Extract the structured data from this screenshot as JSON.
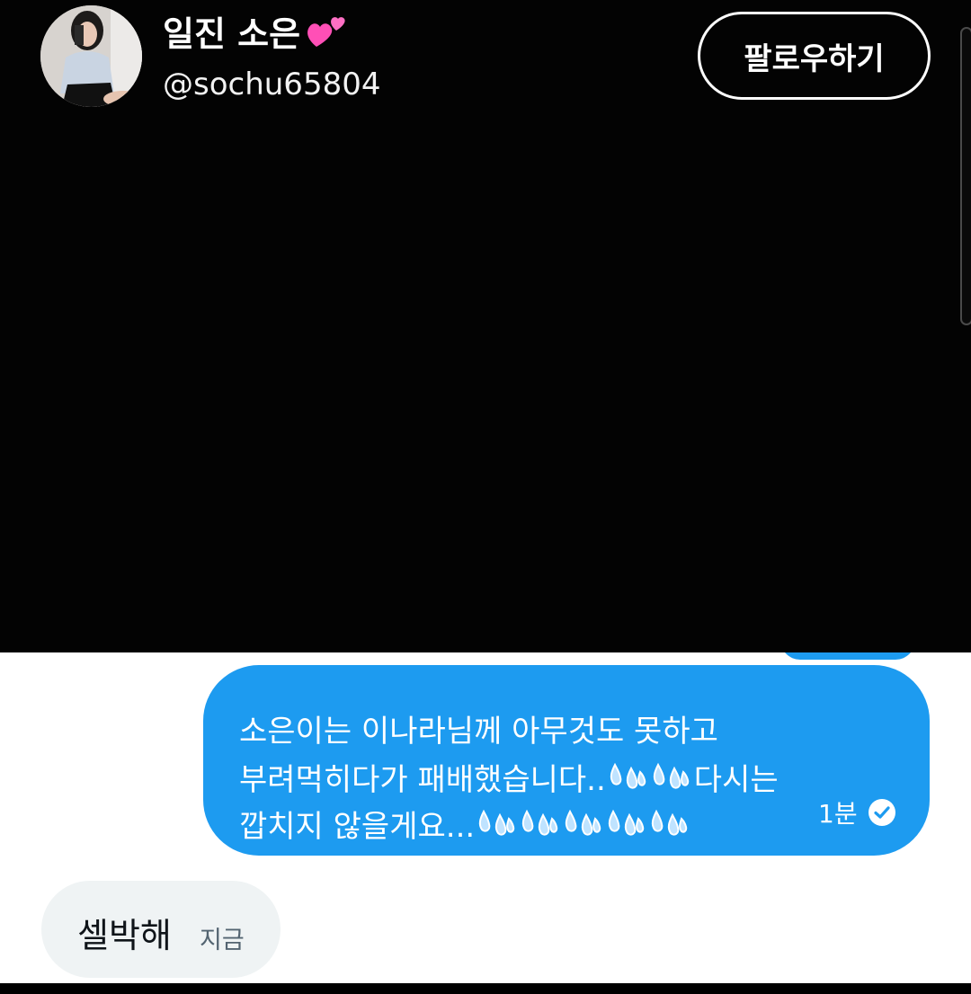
{
  "profile": {
    "display_name": "일진 소은",
    "username": "@sochu65804",
    "follow_label": "팔로우하기",
    "name_emoji_icon": "two-hearts-emoji-icon"
  },
  "messages": {
    "sent": {
      "line1": "소은이는 이나라님께 아무것도 못하고",
      "line2_text": "부려먹히다가 패배했습니다..",
      "line2_suffix": "다시는",
      "line3_text": "깝치지 않을게요...",
      "time": "1분",
      "status_icon": "check-circle-icon",
      "emoji_icon": "sweat-droplets-emoji-icon"
    },
    "received": {
      "text": "셀박해",
      "time": "지금"
    }
  },
  "colors": {
    "sent_bubble": "#1d9bf0",
    "received_bubble": "#eff3f4",
    "background_top": "#030303",
    "background_chat": "#ffffff",
    "heart_pink": "#ff4fb6"
  }
}
